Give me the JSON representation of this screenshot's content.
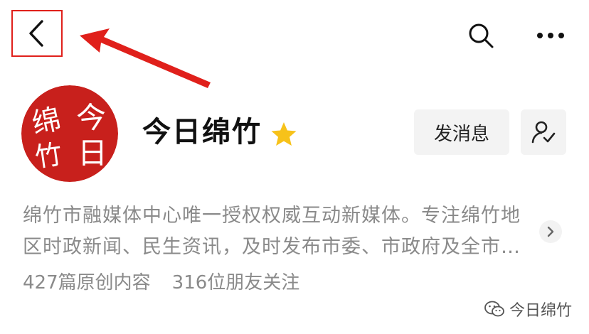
{
  "account": {
    "name": "今日绵竹",
    "avatar_text": [
      "绵",
      "今",
      "竹",
      "日"
    ],
    "description": "绵竹市融媒体中心唯一授权权威互动新媒体。专注绵竹地区时政新闻、民生资讯，及时发布市委、市政府及全市…",
    "original_count": "427",
    "original_label": "篇原创内容",
    "followers_count": "316",
    "followers_label": "位朋友关注"
  },
  "actions": {
    "send_message_label": "发消息"
  },
  "icons": {
    "back": "chevron-left-icon",
    "search": "search-icon",
    "more": "more-dots-icon",
    "star": "star-icon",
    "follow": "user-check-icon",
    "expand": "chevron-right-icon"
  },
  "watermark": {
    "text": "今日绵竹"
  },
  "colors": {
    "annotation_red": "#e0201b",
    "star_yellow": "#f7c21a",
    "avatar_red": "#c8201c",
    "secondary_text": "#8a8a8a"
  }
}
